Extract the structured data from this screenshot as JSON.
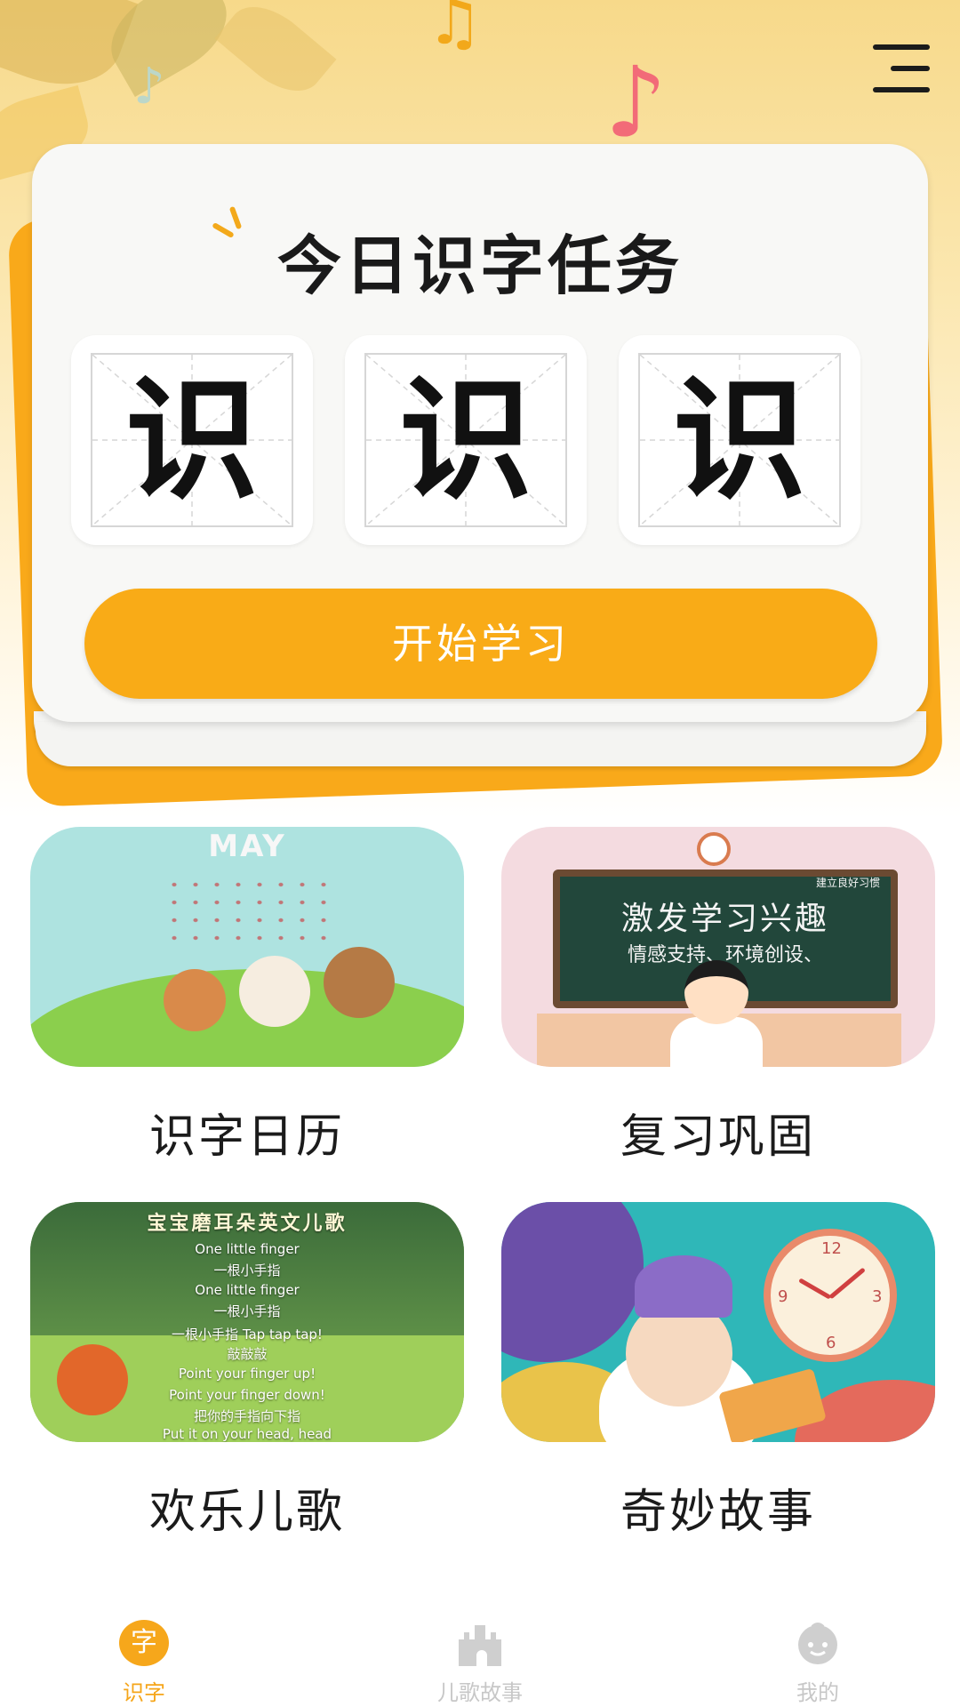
{
  "header": {
    "menu_icon": "menu-icon"
  },
  "task_card": {
    "title": "今日识字任务",
    "characters": [
      "识",
      "识",
      "识"
    ],
    "start_button": "开始学习"
  },
  "tiles": [
    {
      "id": "calendar",
      "label": "识字日历",
      "image_text": "MAY"
    },
    {
      "id": "review",
      "label": "复习巩固",
      "image_text": {
        "board_small": "建立良好习惯",
        "board_title": "激发学习兴趣",
        "board_sub": "情感支持、环境创设、"
      }
    },
    {
      "id": "songs",
      "label": "欢乐儿歌",
      "image_text": {
        "title": "宝宝磨耳朵英文儿歌",
        "lines": [
          "One little finger",
          "一根小手指",
          "One little finger",
          "一根小手指",
          "一根小手指 Tap tap tap!",
          "敲敲敲",
          "Point your finger up!",
          "Point your finger down!",
          "把你的手指向下指",
          "Put it on your head, head"
        ]
      }
    },
    {
      "id": "stories",
      "label": "奇妙故事",
      "image_text": {
        "clock_numbers": [
          "12",
          "3",
          "6",
          "9"
        ]
      }
    }
  ],
  "bottom_nav": [
    {
      "label": "识字",
      "icon": "zi-icon",
      "badge": "字",
      "active": true
    },
    {
      "label": "儿歌故事",
      "icon": "castle-icon",
      "active": false
    },
    {
      "label": "我的",
      "icon": "baby-face-icon",
      "active": false
    }
  ],
  "colors": {
    "accent": "#f9ab17",
    "card_bg": "#f8f8f6",
    "text_dark": "#1b1b1b",
    "nav_inactive": "#c7c7c7"
  }
}
